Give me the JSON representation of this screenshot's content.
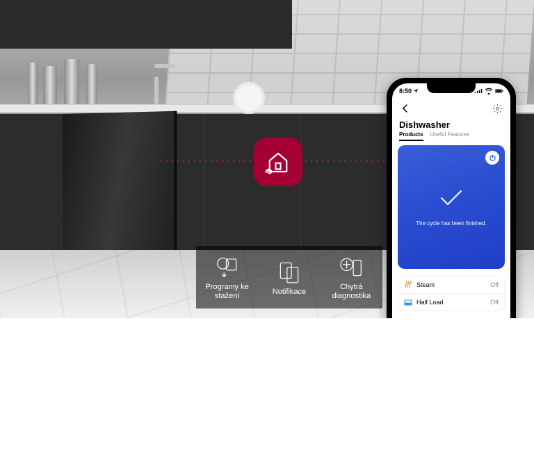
{
  "brand_color": "#a50034",
  "features": [
    {
      "id": "downloads",
      "label": "Programy ke stažení"
    },
    {
      "id": "notifications",
      "label": "Notifikace"
    },
    {
      "id": "smart-diag",
      "label": "Chytrá diagnostika"
    }
  ],
  "phone": {
    "status_time": "8:50",
    "device_title": "Dishwasher",
    "tabs": {
      "products": "Products",
      "useful": "Useful Features"
    },
    "cycle_message": "The cycle has been finished.",
    "options": [
      {
        "name": "Steam",
        "value": "Off",
        "icon": "steam"
      },
      {
        "name": "Half Load",
        "value": "Off",
        "icon": "half"
      }
    ]
  }
}
